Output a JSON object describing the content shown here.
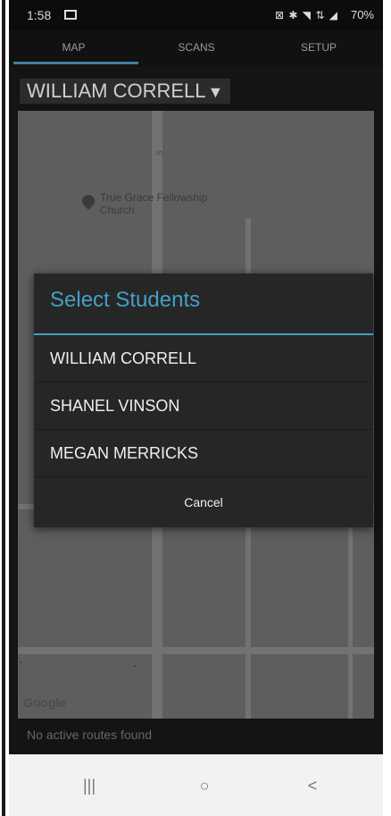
{
  "status_bar": {
    "time": "1:58",
    "status_icons": "⊠ ✱ ◥ ⇅ ◢",
    "battery": "70%"
  },
  "tabs": [
    {
      "label": "MAP"
    },
    {
      "label": "SCANS"
    },
    {
      "label": "SETUP"
    }
  ],
  "student_selector": {
    "selected": "WILLIAM CORRELL",
    "caret": "▼"
  },
  "map": {
    "poi_name": "True Grace Fellowship Church",
    "provider": "Google"
  },
  "footer": {
    "message": "No active routes found"
  },
  "dialog": {
    "title": "Select Students",
    "options": [
      {
        "label": "WILLIAM CORRELL"
      },
      {
        "label": "SHANEL VINSON"
      },
      {
        "label": "MEGAN MERRICKS"
      }
    ],
    "cancel_label": "Cancel"
  },
  "nav_bar": {
    "recents": "|||",
    "home": "○",
    "back": "<"
  }
}
